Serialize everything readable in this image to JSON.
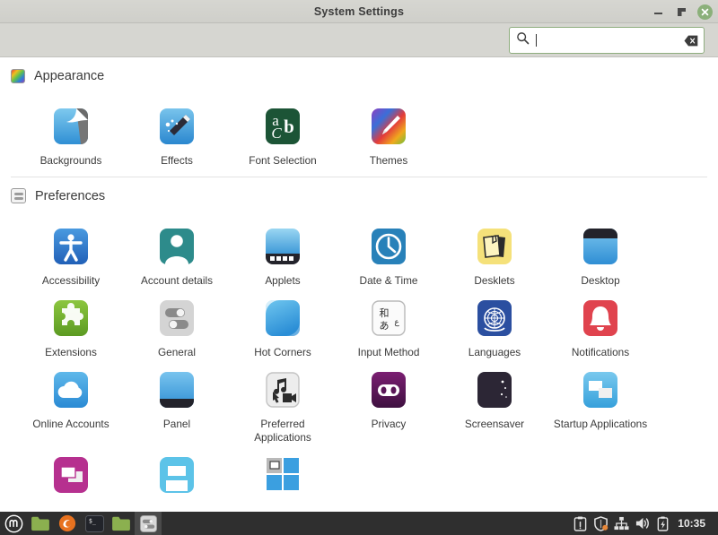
{
  "window": {
    "title": "System Settings",
    "controls": {
      "minimize": "minimize",
      "maximize": "maximize",
      "close": "close"
    }
  },
  "search": {
    "value": "",
    "placeholder": "",
    "icon": "search-icon",
    "clear_icon": "clear-icon"
  },
  "sections": [
    {
      "id": "appearance",
      "title": "Appearance",
      "icon": "appearance-icon",
      "items": [
        {
          "label": "Backgrounds",
          "icon": "backgrounds-icon"
        },
        {
          "label": "Effects",
          "icon": "effects-icon"
        },
        {
          "label": "Font Selection",
          "icon": "font-selection-icon"
        },
        {
          "label": "Themes",
          "icon": "themes-icon"
        }
      ]
    },
    {
      "id": "preferences",
      "title": "Preferences",
      "icon": "preferences-icon",
      "items": [
        {
          "label": "Accessibility",
          "icon": "accessibility-icon"
        },
        {
          "label": "Account details",
          "icon": "account-details-icon"
        },
        {
          "label": "Applets",
          "icon": "applets-icon"
        },
        {
          "label": "Date & Time",
          "icon": "date-time-icon"
        },
        {
          "label": "Desklets",
          "icon": "desklets-icon"
        },
        {
          "label": "Desktop",
          "icon": "desktop-icon"
        },
        {
          "label": "Extensions",
          "icon": "extensions-icon"
        },
        {
          "label": "General",
          "icon": "general-icon"
        },
        {
          "label": "Hot Corners",
          "icon": "hot-corners-icon"
        },
        {
          "label": "Input Method",
          "icon": "input-method-icon"
        },
        {
          "label": "Languages",
          "icon": "languages-icon"
        },
        {
          "label": "Notifications",
          "icon": "notifications-icon"
        },
        {
          "label": "Online Accounts",
          "icon": "online-accounts-icon"
        },
        {
          "label": "Panel",
          "icon": "panel-icon"
        },
        {
          "label": "Preferred Applications",
          "icon": "preferred-applications-icon"
        },
        {
          "label": "Privacy",
          "icon": "privacy-icon"
        },
        {
          "label": "Screensaver",
          "icon": "screensaver-icon"
        },
        {
          "label": "Startup Applications",
          "icon": "startup-applications-icon"
        },
        {
          "label": "",
          "icon": "windows-icon"
        },
        {
          "label": "",
          "icon": "window-preview-icon"
        },
        {
          "label": "",
          "icon": "window-tiling-icon"
        }
      ]
    }
  ],
  "input_method_glyphs": {
    "top": "和",
    "bottom": "あ",
    "side": "ع"
  },
  "font_icon_glyphs": {
    "a": "a",
    "b": "b",
    "c": "C"
  },
  "taskbar": {
    "menu": "menu-button",
    "launchers": [
      {
        "name": "files-launcher",
        "icon": "folder-icon"
      },
      {
        "name": "firefox-launcher",
        "icon": "firefox-icon"
      },
      {
        "name": "terminal-launcher",
        "icon": "terminal-icon"
      }
    ],
    "windows": [
      {
        "name": "file-manager-window",
        "icon": "folder-icon",
        "active": false
      },
      {
        "name": "system-settings-window",
        "icon": "settings-icon",
        "active": true
      }
    ],
    "tray": [
      {
        "name": "update-manager-icon"
      },
      {
        "name": "firewall-shield-icon"
      },
      {
        "name": "network-icon"
      },
      {
        "name": "volume-icon"
      },
      {
        "name": "battery-icon"
      }
    ],
    "clock": "10:35"
  },
  "colors": {
    "titlebar_bg": "#d6d6d1",
    "content_bg": "#ffffff",
    "accent_green": "#8bb07a",
    "taskbar_bg": "#2f2f2f",
    "text": "#3a3a3a"
  }
}
